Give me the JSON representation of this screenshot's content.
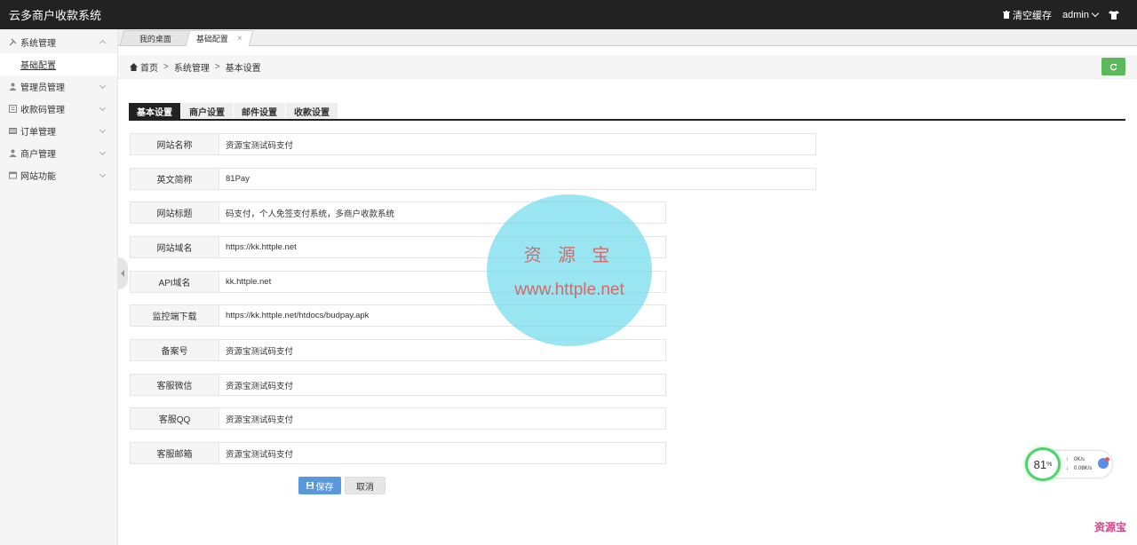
{
  "topbar": {
    "title": "云多商户收款系统",
    "clear_cache": "清空缓存",
    "user": "admin"
  },
  "sidebar": {
    "items": [
      {
        "label": "系统管理",
        "icon": "tools-icon",
        "expanded": true
      },
      {
        "label": "管理员管理",
        "icon": "user-icon"
      },
      {
        "label": "收款码管理",
        "icon": "qrcode-icon"
      },
      {
        "label": "订单管理",
        "icon": "list-icon"
      },
      {
        "label": "商户管理",
        "icon": "user-icon"
      },
      {
        "label": "网站功能",
        "icon": "window-icon"
      }
    ],
    "subitem": "基础配置"
  },
  "tabs": {
    "desktop": "我的桌面",
    "config": "基础配置",
    "close": "×"
  },
  "breadcrumb": {
    "home": "首页",
    "sep": ">",
    "level1": "系统管理",
    "level2": "基本设置"
  },
  "form_tabs": [
    "基本设置",
    "商户设置",
    "邮件设置",
    "收款设置"
  ],
  "form": {
    "fields": [
      {
        "label": "网站名称",
        "value": "资源宝测试码支付"
      },
      {
        "label": "英文简称",
        "value": "81Pay"
      },
      {
        "label": "网站标题",
        "value": "码支付，个人免签支付系统，多商户收款系统"
      },
      {
        "label": "网站域名",
        "value": "https://kk.httple.net"
      },
      {
        "label": "API域名",
        "value": "kk.httple.net"
      },
      {
        "label": "监控端下载",
        "value": "https://kk.httple.net/htdocs/budpay.apk"
      },
      {
        "label": "备案号",
        "value": "资源宝测试码支付"
      },
      {
        "label": "客服微信",
        "value": "资源宝测试码支付"
      },
      {
        "label": "客服QQ",
        "value": "资源宝测试码支付"
      },
      {
        "label": "客服邮箱",
        "value": "资源宝测试码支付"
      }
    ],
    "save": "保存",
    "cancel": "取消"
  },
  "watermark": {
    "line1": "资 源 宝",
    "line2": "www.httple.net"
  },
  "speed_widget": {
    "percent": "81",
    "unit": "%",
    "up": "0K/s",
    "down": "0.08K/s"
  },
  "brandmark": "资源宝",
  "colors": {
    "topbar": "#222222",
    "accent_green": "#5cb85c",
    "save_blue": "#5a98de"
  }
}
